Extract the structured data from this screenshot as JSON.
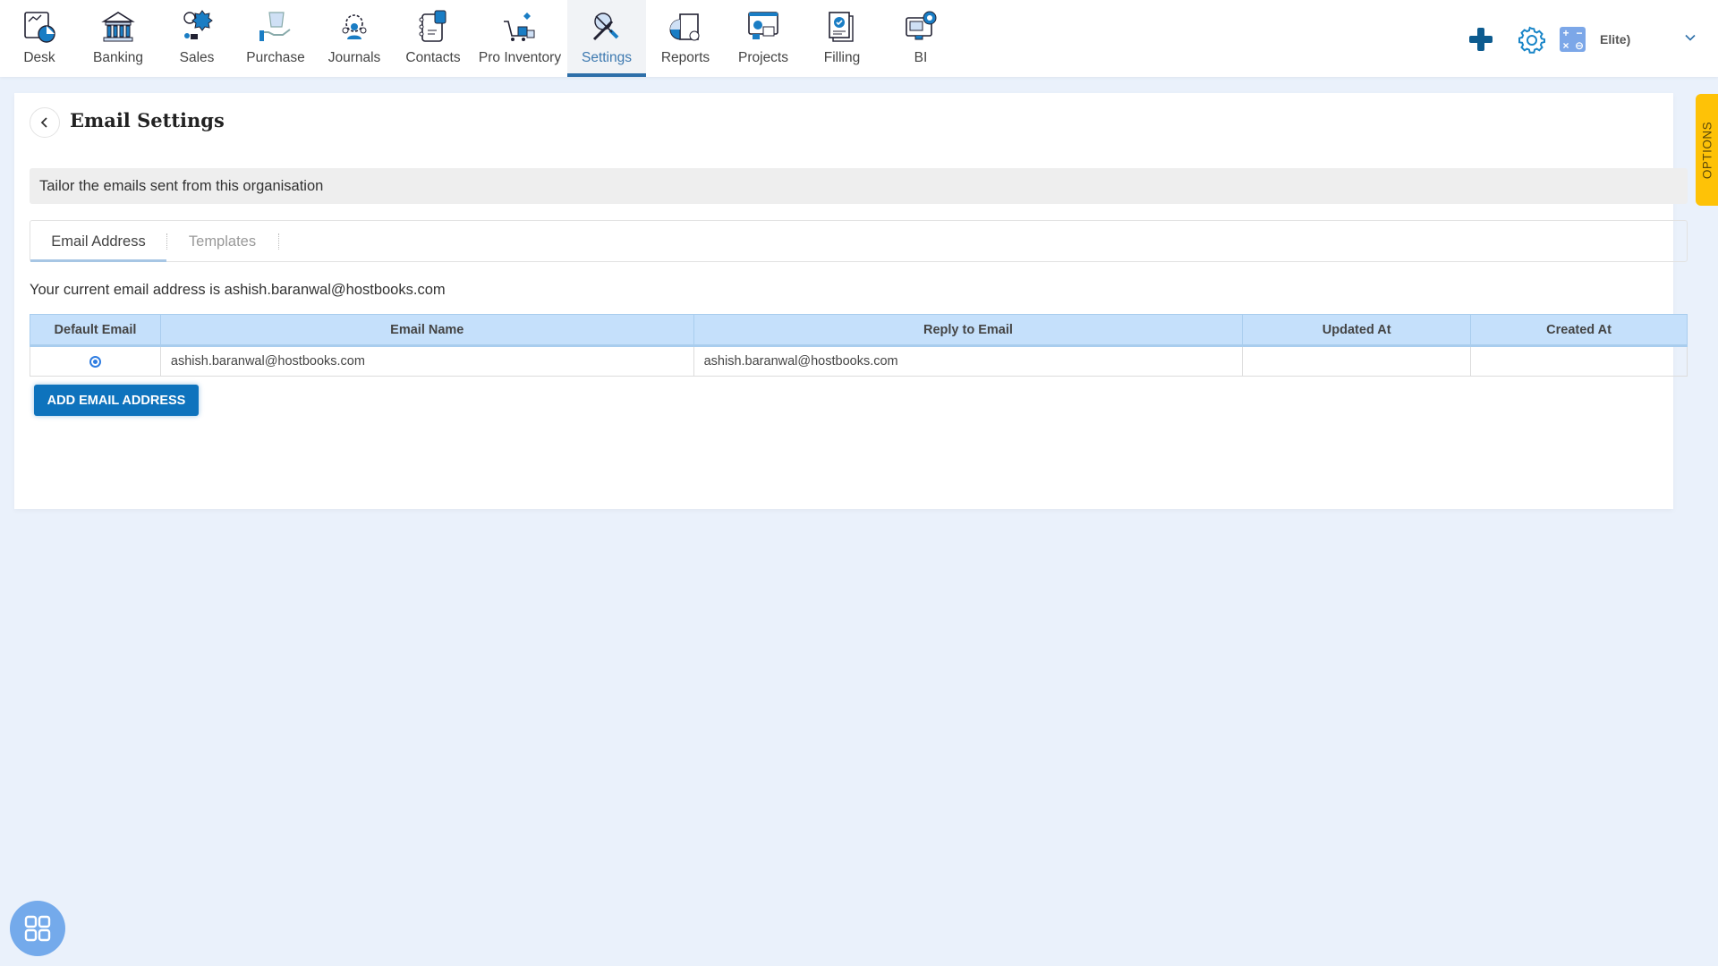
{
  "nav": {
    "items": [
      {
        "label": "Desk",
        "icon": "desk-icon"
      },
      {
        "label": "Banking",
        "icon": "bank-icon"
      },
      {
        "label": "Sales",
        "icon": "sales-icon"
      },
      {
        "label": "Purchase",
        "icon": "purchase-icon"
      },
      {
        "label": "Journals",
        "icon": "journals-icon"
      },
      {
        "label": "Contacts",
        "icon": "contacts-icon"
      },
      {
        "label": "Pro Inventory",
        "icon": "inventory-icon"
      },
      {
        "label": "Settings",
        "icon": "settings-icon",
        "active": true
      },
      {
        "label": "Reports",
        "icon": "reports-icon"
      },
      {
        "label": "Projects",
        "icon": "projects-icon"
      },
      {
        "label": "Filling",
        "icon": "filling-icon"
      },
      {
        "label": "BI",
        "icon": "bi-icon"
      }
    ],
    "org_label": "Elite)",
    "calc_symbols": [
      "+",
      "−",
      "×",
      "⊖"
    ]
  },
  "page": {
    "title": "Email Settings",
    "info": "Tailor the emails sent from this organisation",
    "tabs": [
      {
        "label": "Email Address",
        "active": true
      },
      {
        "label": "Templates",
        "active": false
      }
    ],
    "current_email_text": "Your current email address is ashish.baranwal@hostbooks.com",
    "table": {
      "headers": [
        "Default Email",
        "Email Name",
        "Reply to Email",
        "Updated At",
        "Created At"
      ],
      "rows": [
        {
          "default": true,
          "email_name": "ashish.baranwal@hostbooks.com",
          "reply_to": "ashish.baranwal@hostbooks.com",
          "updated_at": "",
          "created_at": ""
        }
      ]
    },
    "add_button": "ADD EMAIL ADDRESS"
  },
  "side_tab": "OPTIONS",
  "colors": {
    "accent": "#0e73bd",
    "header_bg": "#c5e0fb",
    "options_tab": "#fec207"
  }
}
